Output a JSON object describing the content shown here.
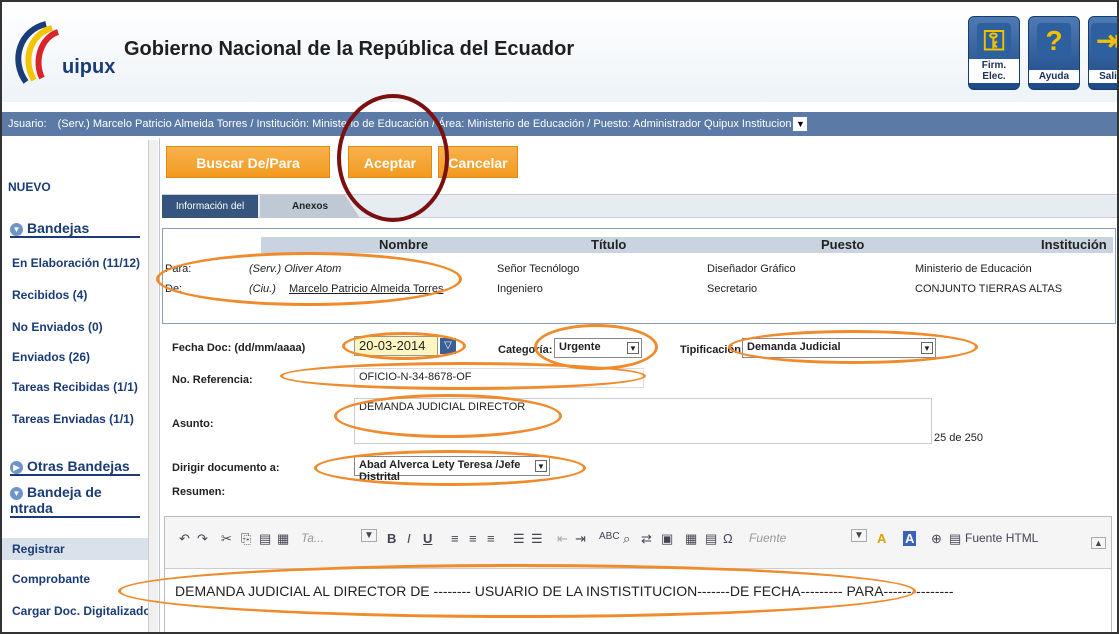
{
  "app": {
    "logo_text": "uipux",
    "title": "Gobierno Nacional de la República del Ecuador"
  },
  "header_buttons": [
    {
      "label": "Firm. Elec.",
      "icon": "usb-key-icon"
    },
    {
      "label": "Ayuda",
      "icon": "help-icon"
    },
    {
      "label": "Sali",
      "icon": "exit-icon"
    }
  ],
  "user": {
    "label": "Jsuario:",
    "value": "(Serv.) Marcelo Patricio Almeida Torres / Institución: Ministerio de Educación / Área: Ministerio de Educación / Puesto: Administrador Quipux Institucion"
  },
  "sidebar": {
    "nuevo": "NUEVO",
    "bandejas": "Bandejas",
    "items": [
      "En Elaboración (11/12)",
      "Recibidos (4)",
      "No Enviados (0)",
      "Enviados (26)",
      "Tareas Recibidas (1/1)",
      "Tareas Enviadas (1/1)"
    ],
    "otras": "Otras Bandejas",
    "bandeja_entrada_1": "Bandeja de",
    "bandeja_entrada_2": "ntrada",
    "registrar": "Registrar",
    "comprobante": "Comprobante",
    "cargar": "Cargar Doc. Digitalizado"
  },
  "actions": {
    "buscar": "Buscar De/Para",
    "aceptar": "Aceptar",
    "cancelar": "Cancelar"
  },
  "tabs": [
    "Información del Docu.",
    "Anexos"
  ],
  "dest_headers": [
    "Nombre",
    "Título",
    "Puesto",
    "Institución"
  ],
  "rows": [
    {
      "label": "Para:",
      "nombre": "(Serv.) Oliver Atom",
      "titulo": "Señor Tecnólogo",
      "puesto": "Diseñador Gráfico",
      "institucion": "Ministerio de Educación"
    },
    {
      "label": "De:",
      "nombre_prefix": "(Ciu.)",
      "nombre": "Marcelo Patricio Almeida Torres",
      "titulo": "Ingeniero",
      "puesto": "Secretario",
      "institucion": "CONJUNTO TIERRAS ALTAS"
    }
  ],
  "form": {
    "fecha_label": "Fecha Doc: (dd/mm/aaaa)",
    "fecha": "20-03-2014",
    "categoria_label": "Categoría:",
    "categoria": "Urgente",
    "tipificacion_label": "Tipificación:",
    "tipificacion": "Demanda Judicial",
    "referencia_label": "No. Referencia:",
    "referencia": "OFICIO-N-34-8678-OF",
    "asunto_label": "Asunto:",
    "asunto": "DEMANDA JUDICIAL DIRECTOR",
    "asunto_count": "25 de 250",
    "dirigir_label": "Dirigir documento a:",
    "dirigir": "Abad Alverca Lety Teresa /Jefe Distrital",
    "resumen_label": "Resumen:"
  },
  "editor": {
    "font_placeholder": "Fuente",
    "size_placeholder": "Ta...",
    "html_btn": "Fuente HTML",
    "body": "DEMANDA JUDICIAL AL DIRECTOR DE -------- USUARIO DE LA INSTISTITUCION-------DE FECHA--------- PARA---------------"
  },
  "colors": {
    "accent": "#f29a1f",
    "highlight": "#f08a2a",
    "nav": "#1a3b75"
  }
}
